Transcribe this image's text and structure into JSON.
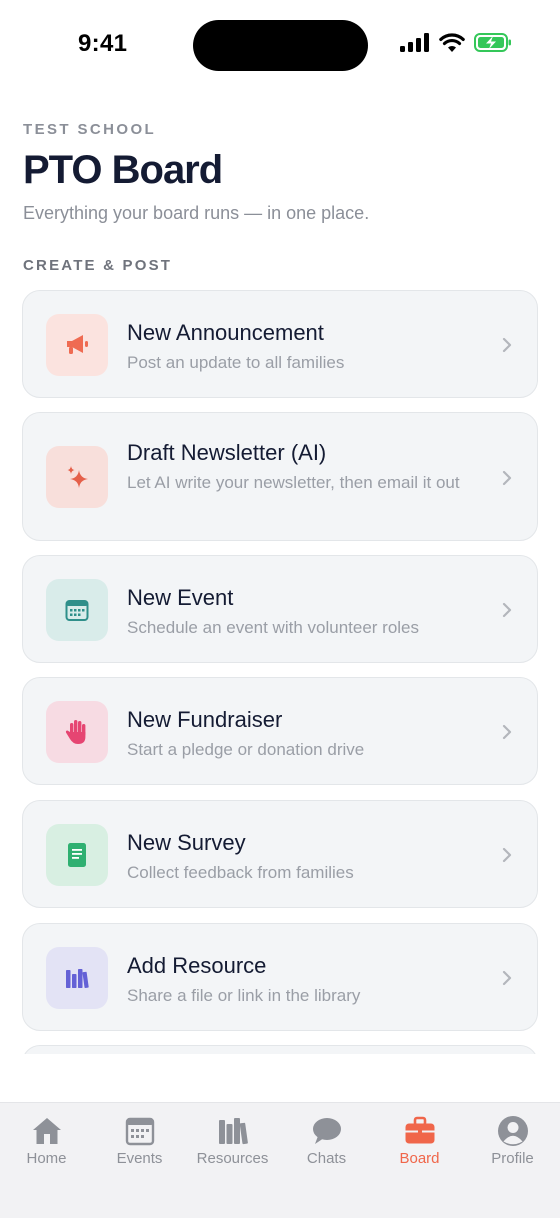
{
  "status_bar": {
    "time": "9:41"
  },
  "header": {
    "school": "TEST SCHOOL",
    "title": "PTO Board",
    "subtitle": "Everything your board runs — in one place."
  },
  "section_label": "CREATE & POST",
  "actions": [
    {
      "title": "New Announcement",
      "description": "Post an update to all families",
      "icon": "megaphone-icon",
      "color": "#ef6b52",
      "bg": "#fbe3df"
    },
    {
      "title": "Draft Newsletter (AI)",
      "description": "Let AI write your newsletter, then email it out",
      "icon": "sparkle-icon",
      "color": "#e5604a",
      "bg": "#f8dfdb"
    },
    {
      "title": "New Event",
      "description": "Schedule an event with volunteer roles",
      "icon": "calendar-icon",
      "color": "#2f8f8a",
      "bg": "#d9ecea"
    },
    {
      "title": "New Fundraiser",
      "description": "Start a pledge or donation drive",
      "icon": "hand-icon",
      "color": "#e64572",
      "bg": "#f7dbe3"
    },
    {
      "title": "New Survey",
      "description": "Collect feedback from families",
      "icon": "document-icon",
      "color": "#2fb071",
      "bg": "#d8efe2"
    },
    {
      "title": "Add Resource",
      "description": "Share a file or link in the library",
      "icon": "books-icon",
      "color": "#6461d6",
      "bg": "#e3e3f5"
    }
  ],
  "tabs": [
    {
      "label": "Home",
      "icon": "home-icon"
    },
    {
      "label": "Events",
      "icon": "calendar-icon"
    },
    {
      "label": "Resources",
      "icon": "books-icon"
    },
    {
      "label": "Chats",
      "icon": "chat-bubble-icon"
    },
    {
      "label": "Board",
      "icon": "briefcase-icon",
      "active": true
    },
    {
      "label": "Profile",
      "icon": "person-icon"
    }
  ],
  "colors": {
    "accent": "#f0664a",
    "title": "#141b33",
    "muted": "#8b8f98",
    "battery": "#34c759"
  }
}
